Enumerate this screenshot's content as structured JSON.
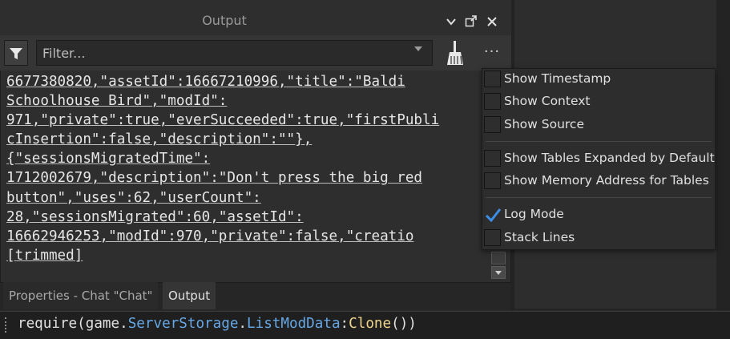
{
  "panel": {
    "title": "Output",
    "filter_placeholder": "Filter...",
    "more_label": "···"
  },
  "log_lines": [
    "6677380820,\"assetId\":16667210996,\"title\":\"Baldi",
    "Schoolhouse Bird\",\"modId\":",
    "971,\"private\":true,\"everSucceeded\":true,\"firstPubli",
    "cInsertion\":false,\"description\":\"\"},",
    "{\"sessionsMigratedTime\":",
    "1712002679,\"description\":\"Don't press the big red",
    "button\",\"uses\":62,\"userCount\":",
    "28,\"sessionsMigrated\":60,\"assetId\":",
    "16662946253,\"modId\":970,\"private\":false,\"creatio",
    "[trimmed]"
  ],
  "tabs": {
    "properties": "Properties - Chat \"Chat\"",
    "output": "Output"
  },
  "command": {
    "t1": "require",
    "t2": "(",
    "t3": "game",
    "t4": ".",
    "t5": "ServerStorage",
    "t6": ".",
    "t7": "ListModData",
    "t8": ":",
    "t9": "Clone",
    "t10": "())"
  },
  "menu": {
    "show_timestamp": "Show Timestamp",
    "show_context": "Show Context",
    "show_source": "Show Source",
    "show_tables_expanded": "Show Tables Expanded by Default",
    "show_memory_address": "Show Memory Address for Tables",
    "log_mode": "Log Mode",
    "stack_lines": "Stack Lines"
  },
  "menu_state": {
    "show_timestamp": false,
    "show_context": false,
    "show_source": false,
    "show_tables_expanded": false,
    "show_memory_address": false,
    "log_mode": true,
    "stack_lines": false
  },
  "colors": {
    "background": "#2e2e2e",
    "check_accent": "#3d8ee6",
    "property_blue": "#66a8e6",
    "method_yellow": "#f0d68c"
  },
  "icons": {
    "filter": "funnel-icon",
    "clear": "broom-icon",
    "dock": "dock-icon",
    "close": "close-icon",
    "dropdown": "chevron-down-icon"
  }
}
